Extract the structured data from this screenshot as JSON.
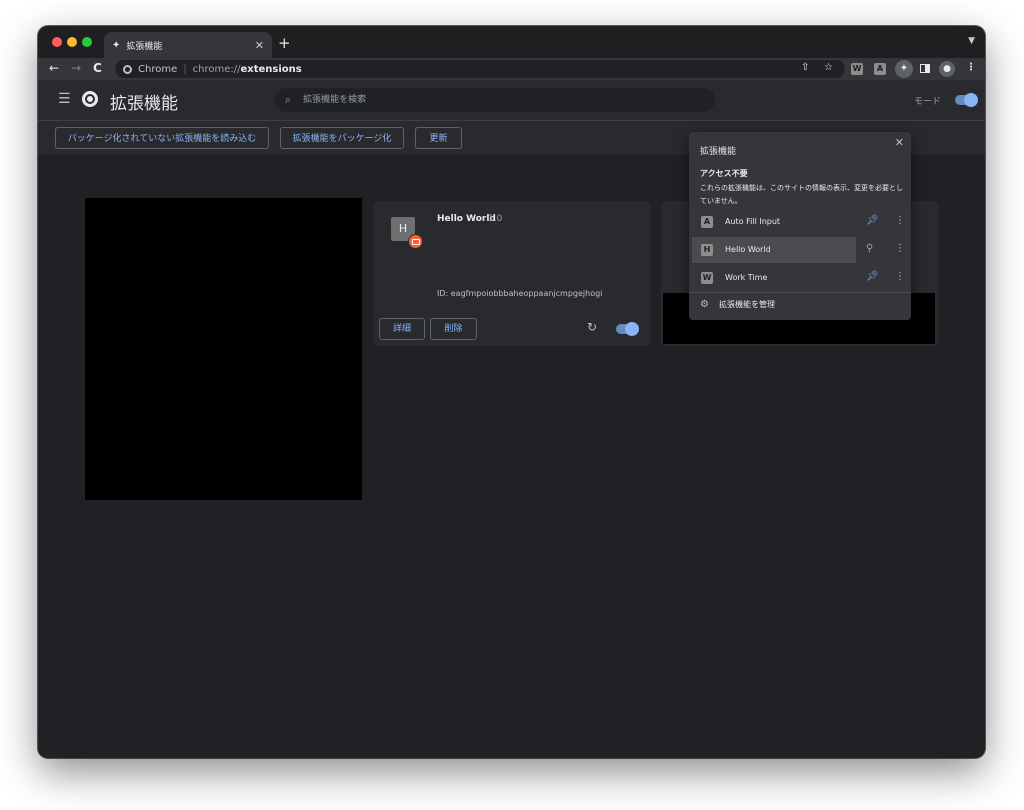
{
  "tab": {
    "title": "拡張機能",
    "close": "✕",
    "new_tab": "+"
  },
  "toolbar": {
    "back": "←",
    "forward": "→",
    "reload": "C",
    "omnibox": {
      "label": "Chrome",
      "separator": "|",
      "scheme": "chrome://",
      "host": "extensions"
    },
    "share": "⇧",
    "bookmark": "☆",
    "pinned_extensions": [
      "W",
      "A"
    ],
    "puzzle": "✦",
    "menu": "⋮"
  },
  "header": {
    "title": "拡張機能",
    "search_placeholder": "拡張機能を検索",
    "dev_mode_label": "モード"
  },
  "actions": {
    "load_unpacked": "パッケージ化されていない拡張機能を読み込む",
    "pack": "拡張機能をパッケージ化",
    "update": "更新"
  },
  "extension_card": {
    "icon_letter": "H",
    "name": "Hello World",
    "version": "1.0",
    "id_text": "ID: eagfmpoiobbbaheoppaanjcmpgejhogi",
    "details_label": "詳細",
    "remove_label": "削除",
    "enabled": true
  },
  "popup": {
    "title": "拡張機能",
    "close": "✕",
    "section_title": "アクセス不要",
    "section_desc": "これらの拡張機能は、このサイトの情報の表示、変更を必要としていません。",
    "items": [
      {
        "letter": "A",
        "name": "Auto Fill Input",
        "pinned": true
      },
      {
        "letter": "H",
        "name": "Hello World",
        "pinned": false
      },
      {
        "letter": "W",
        "name": "Work Time",
        "pinned": true
      }
    ],
    "manage_label": "拡張機能を管理"
  }
}
